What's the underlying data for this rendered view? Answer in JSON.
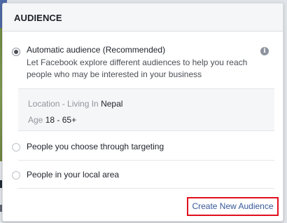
{
  "panel": {
    "title": "AUDIENCE"
  },
  "options": [
    {
      "label": "Automatic audience (Recommended)",
      "description": "Let Facebook explore different audiences to help you reach people who may be interested in your business",
      "selected": true
    },
    {
      "label": "People you choose through targeting",
      "selected": false
    },
    {
      "label": "People in your local area",
      "selected": false
    }
  ],
  "summary": {
    "location_label": "Location - Living In",
    "location_value": "Nepal",
    "age_label": "Age",
    "age_value": "18 - 65+"
  },
  "info_icon": {
    "name": "info-icon",
    "glyph": "i"
  },
  "footer": {
    "create_link": "Create New Audience"
  },
  "colors": {
    "highlight_border": "#e0101e",
    "link": "#365899"
  }
}
